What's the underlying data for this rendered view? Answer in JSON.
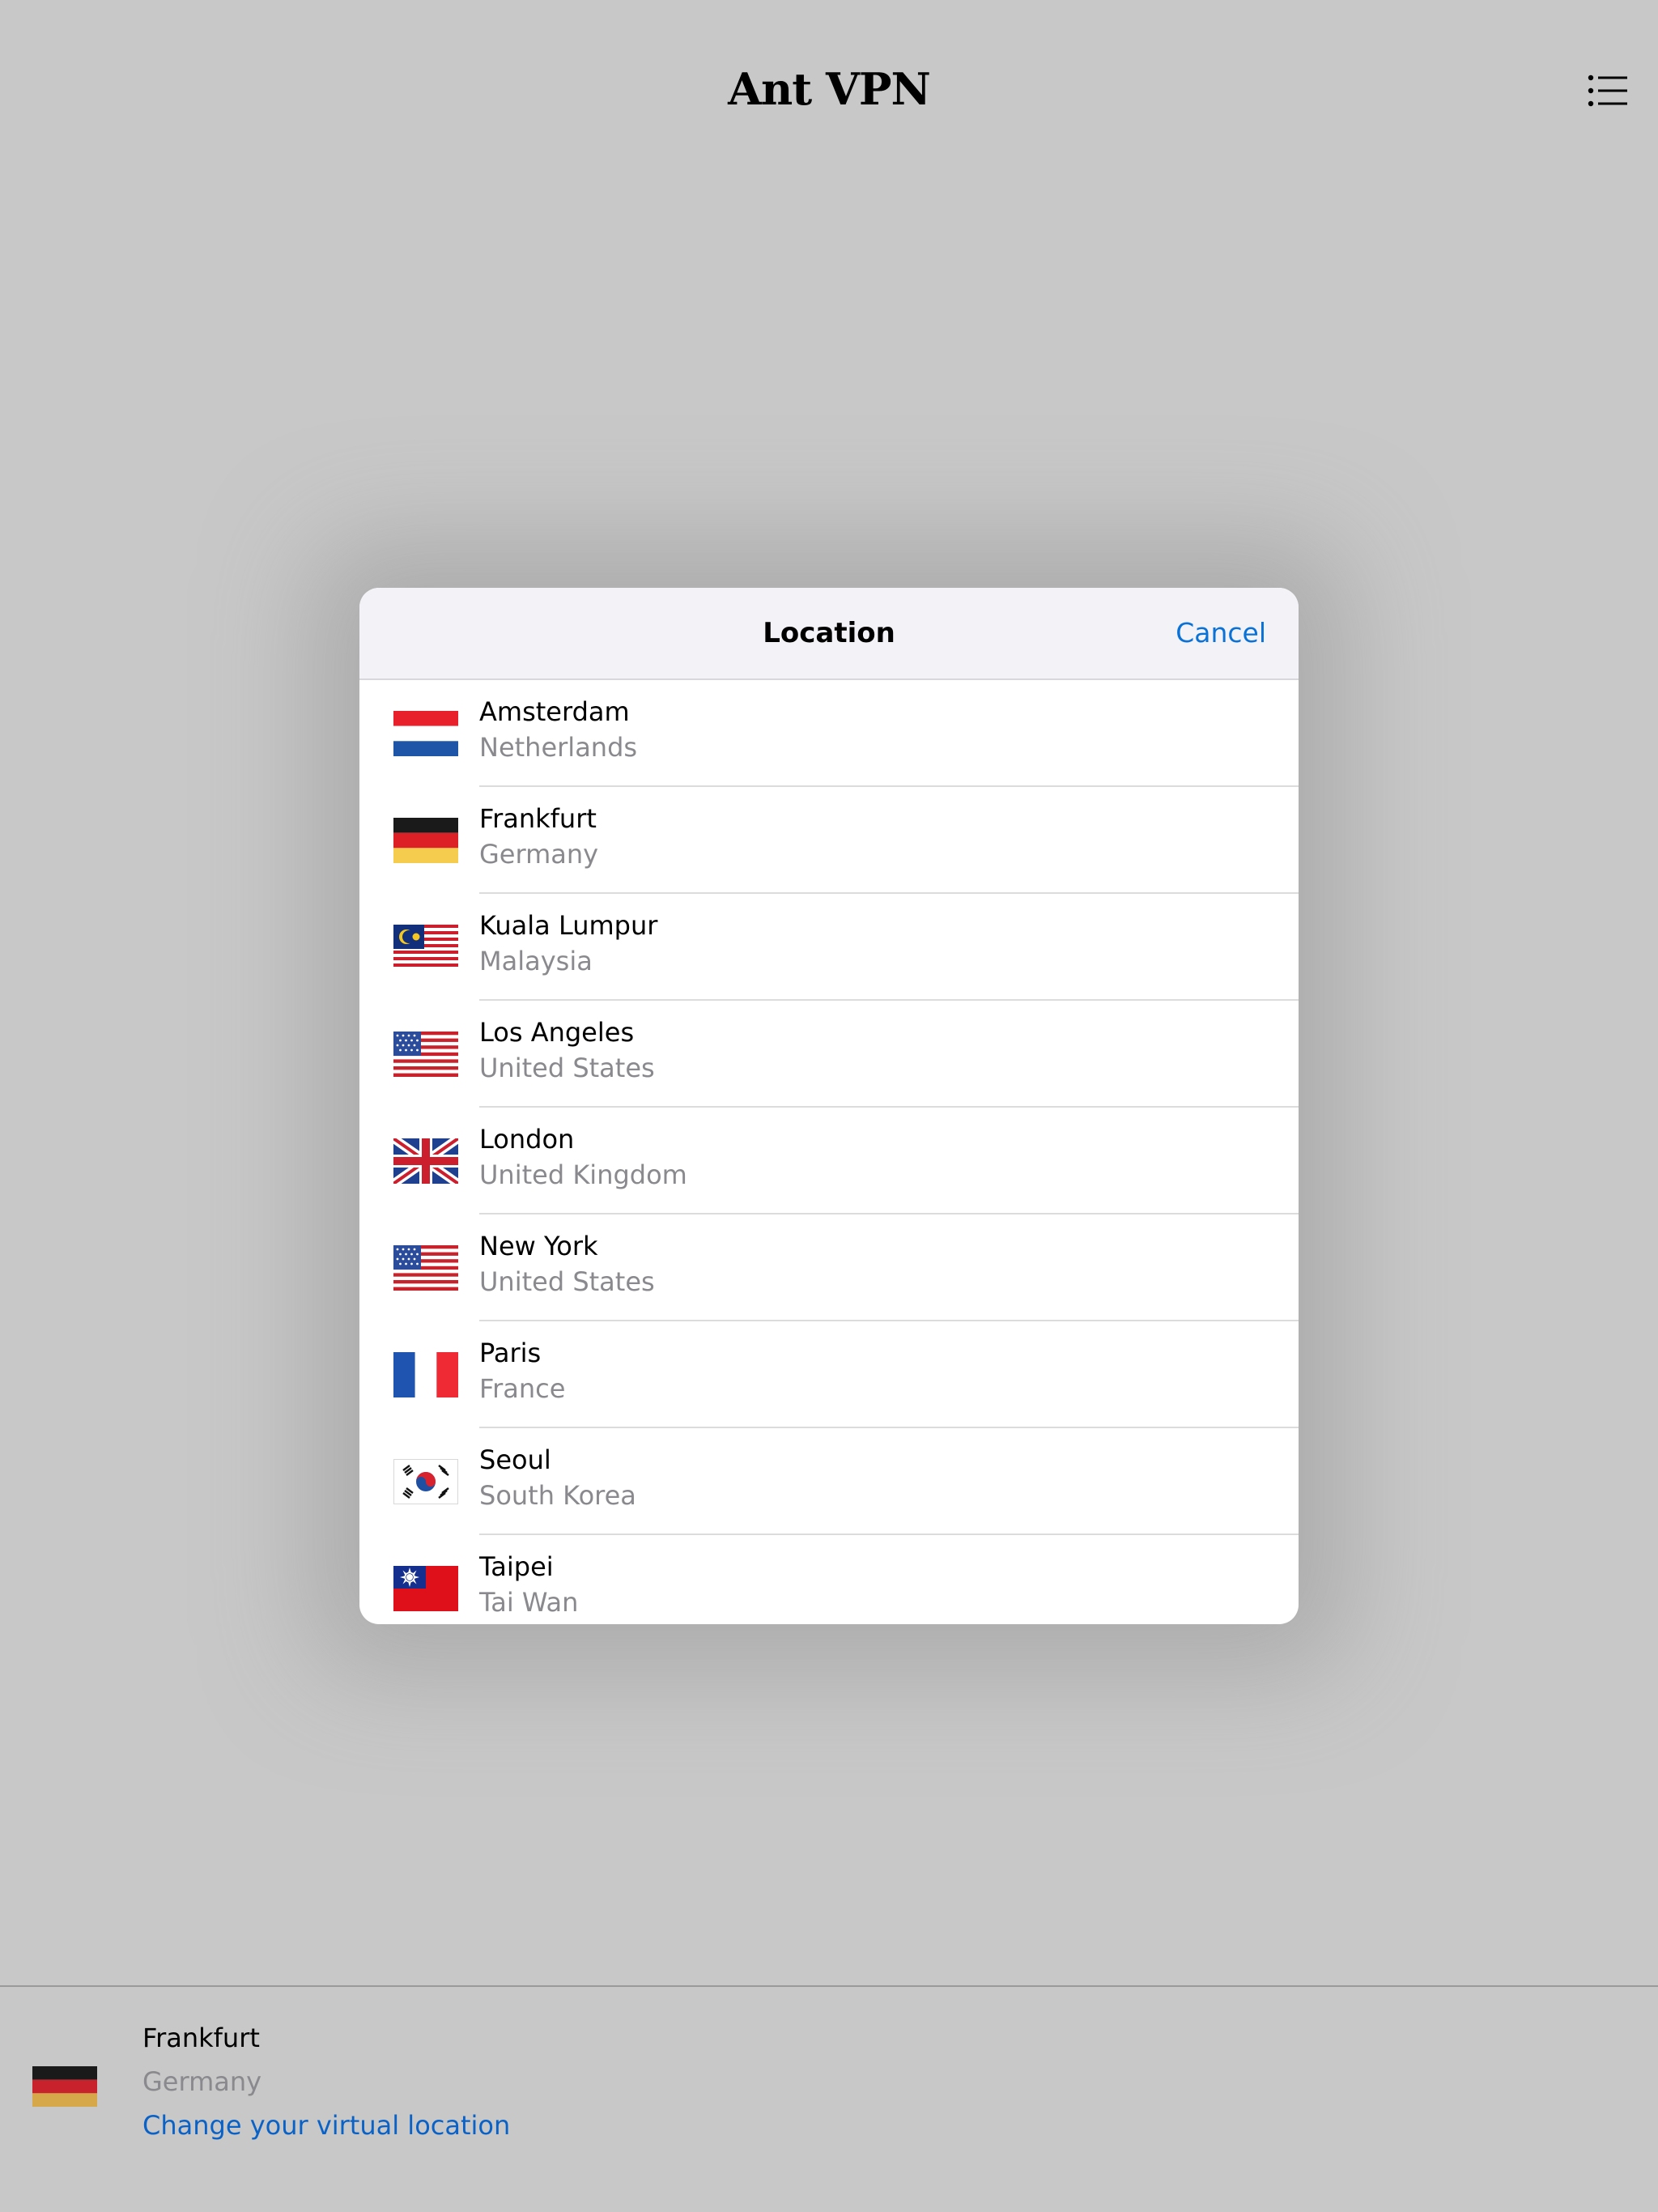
{
  "app": {
    "title": "Ant VPN"
  },
  "modal": {
    "title": "Location",
    "cancel_label": "Cancel",
    "locations": [
      {
        "city": "Amsterdam",
        "country": "Netherlands",
        "flag": "netherlands-flag-icon"
      },
      {
        "city": "Frankfurt",
        "country": "Germany",
        "flag": "germany-flag-icon"
      },
      {
        "city": "Kuala Lumpur",
        "country": "Malaysia",
        "flag": "malaysia-flag-icon"
      },
      {
        "city": "Los Angeles",
        "country": "United States",
        "flag": "usa-flag-icon"
      },
      {
        "city": "London",
        "country": "United Kingdom",
        "flag": "uk-flag-icon"
      },
      {
        "city": "New York",
        "country": "United States",
        "flag": "usa-flag-icon"
      },
      {
        "city": "Paris",
        "country": "France",
        "flag": "france-flag-icon"
      },
      {
        "city": "Seoul",
        "country": "South Korea",
        "flag": "south-korea-flag-icon"
      },
      {
        "city": "Taipei",
        "country": "Tai Wan",
        "flag": "taiwan-flag-icon"
      }
    ]
  },
  "current": {
    "city": "Frankfurt",
    "country": "Germany",
    "change_label": "Change your virtual location",
    "flag": "germany-flag-icon"
  },
  "colors": {
    "background": "#c8c8c8",
    "accent": "#0a72d6",
    "secondary_text": "#8a8a8e"
  }
}
